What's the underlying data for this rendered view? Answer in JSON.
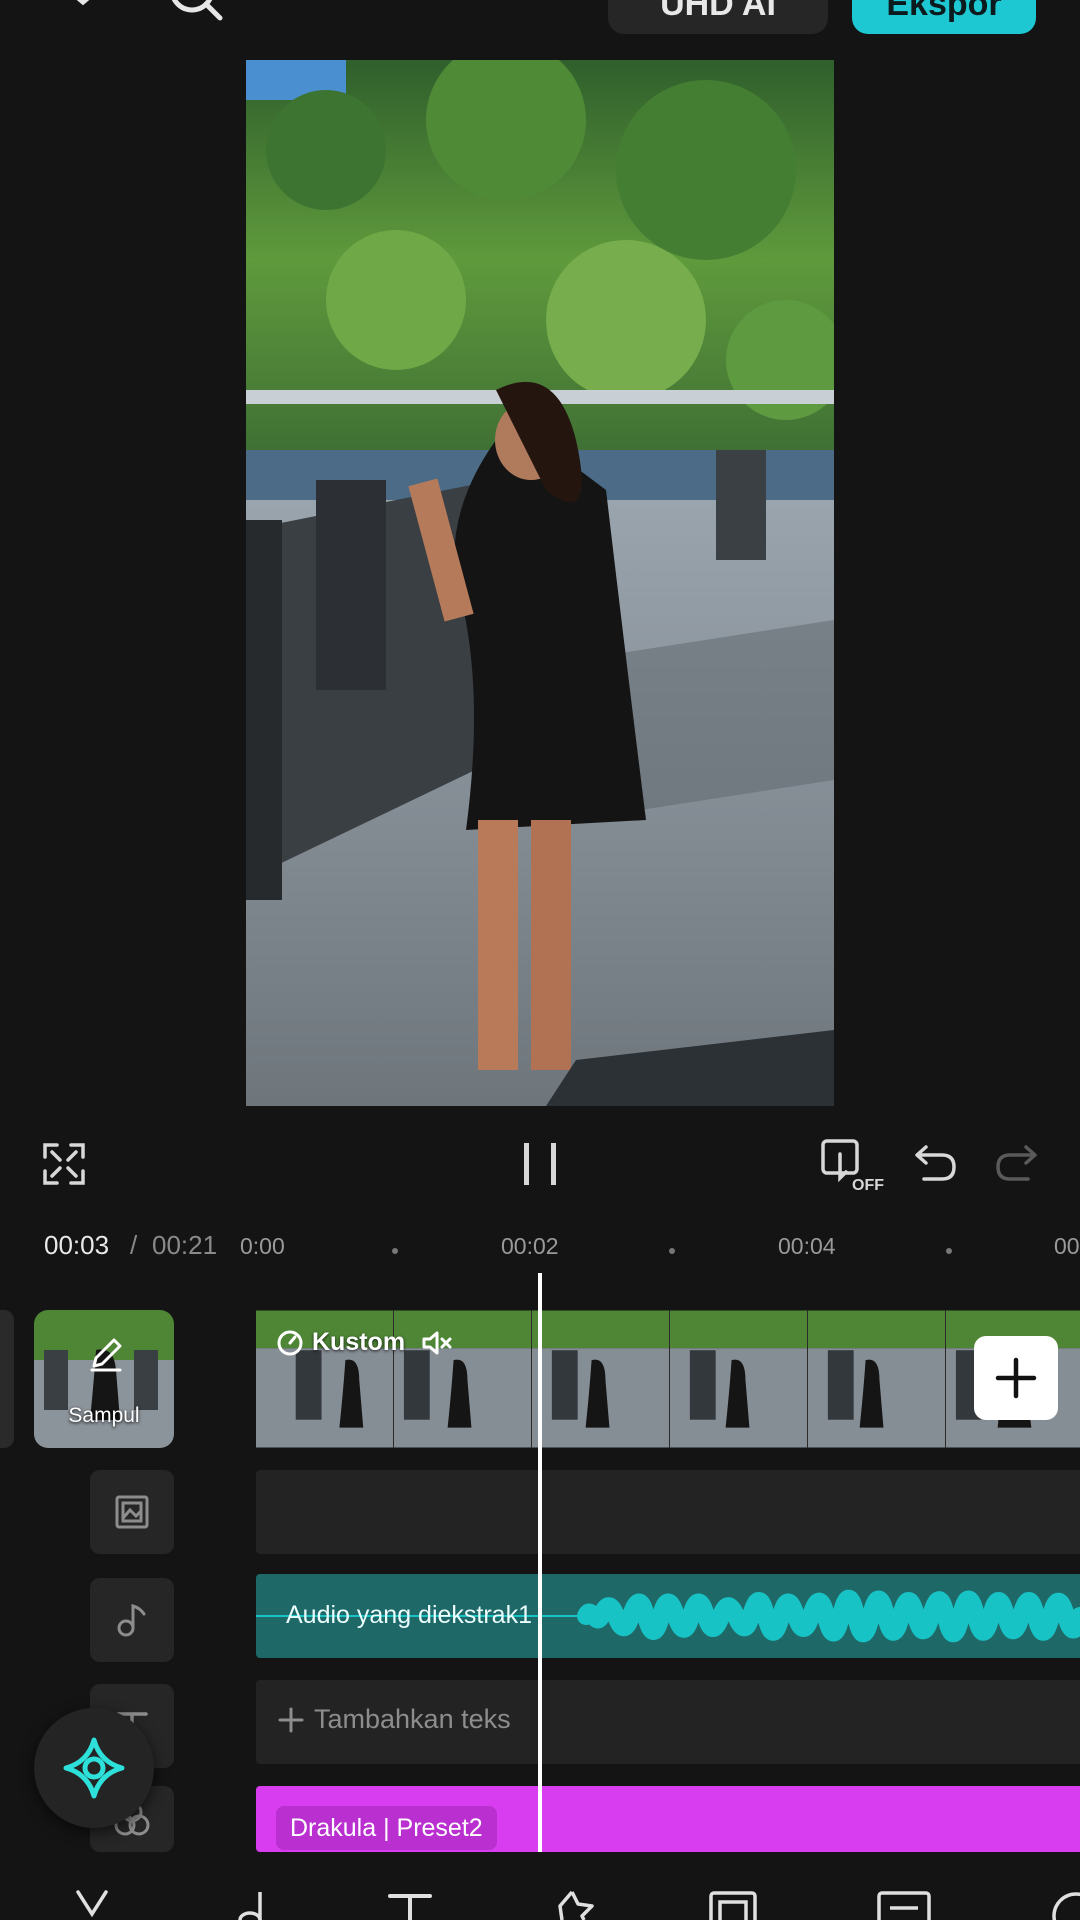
{
  "header": {
    "quality_label": "UHD AI",
    "export_label": "Ekspor"
  },
  "timeline": {
    "current_time": "00:03",
    "separator": "/",
    "total_time": "00:21",
    "ticks": [
      "0:00",
      "00:02",
      "00:04",
      "00"
    ]
  },
  "video_track": {
    "cover_label": "Sampul",
    "clip_label": "Kustom"
  },
  "audio_track": {
    "label": "Audio yang diekstrak1"
  },
  "text_track": {
    "placeholder": "Tambahkan teks"
  },
  "filter_track": {
    "label": "Drakula | Preset2"
  },
  "colors": {
    "accent": "#1ec8d3",
    "audio_wave": "#18c3c6",
    "filter": "#d83ef0"
  },
  "icons": {
    "top": [
      "close-icon",
      "search-icon"
    ],
    "controls": [
      "fullscreen-icon",
      "pause-icon",
      "keyframe-off-icon",
      "undo-icon",
      "redo-icon"
    ],
    "side": [
      "overlay-icon",
      "music-icon",
      "text-icon",
      "effects-icon"
    ],
    "bottom": [
      "cut-icon",
      "audio-icon",
      "text-icon",
      "sticker-icon",
      "overlay-icon",
      "caption-icon",
      "more-icon"
    ]
  }
}
